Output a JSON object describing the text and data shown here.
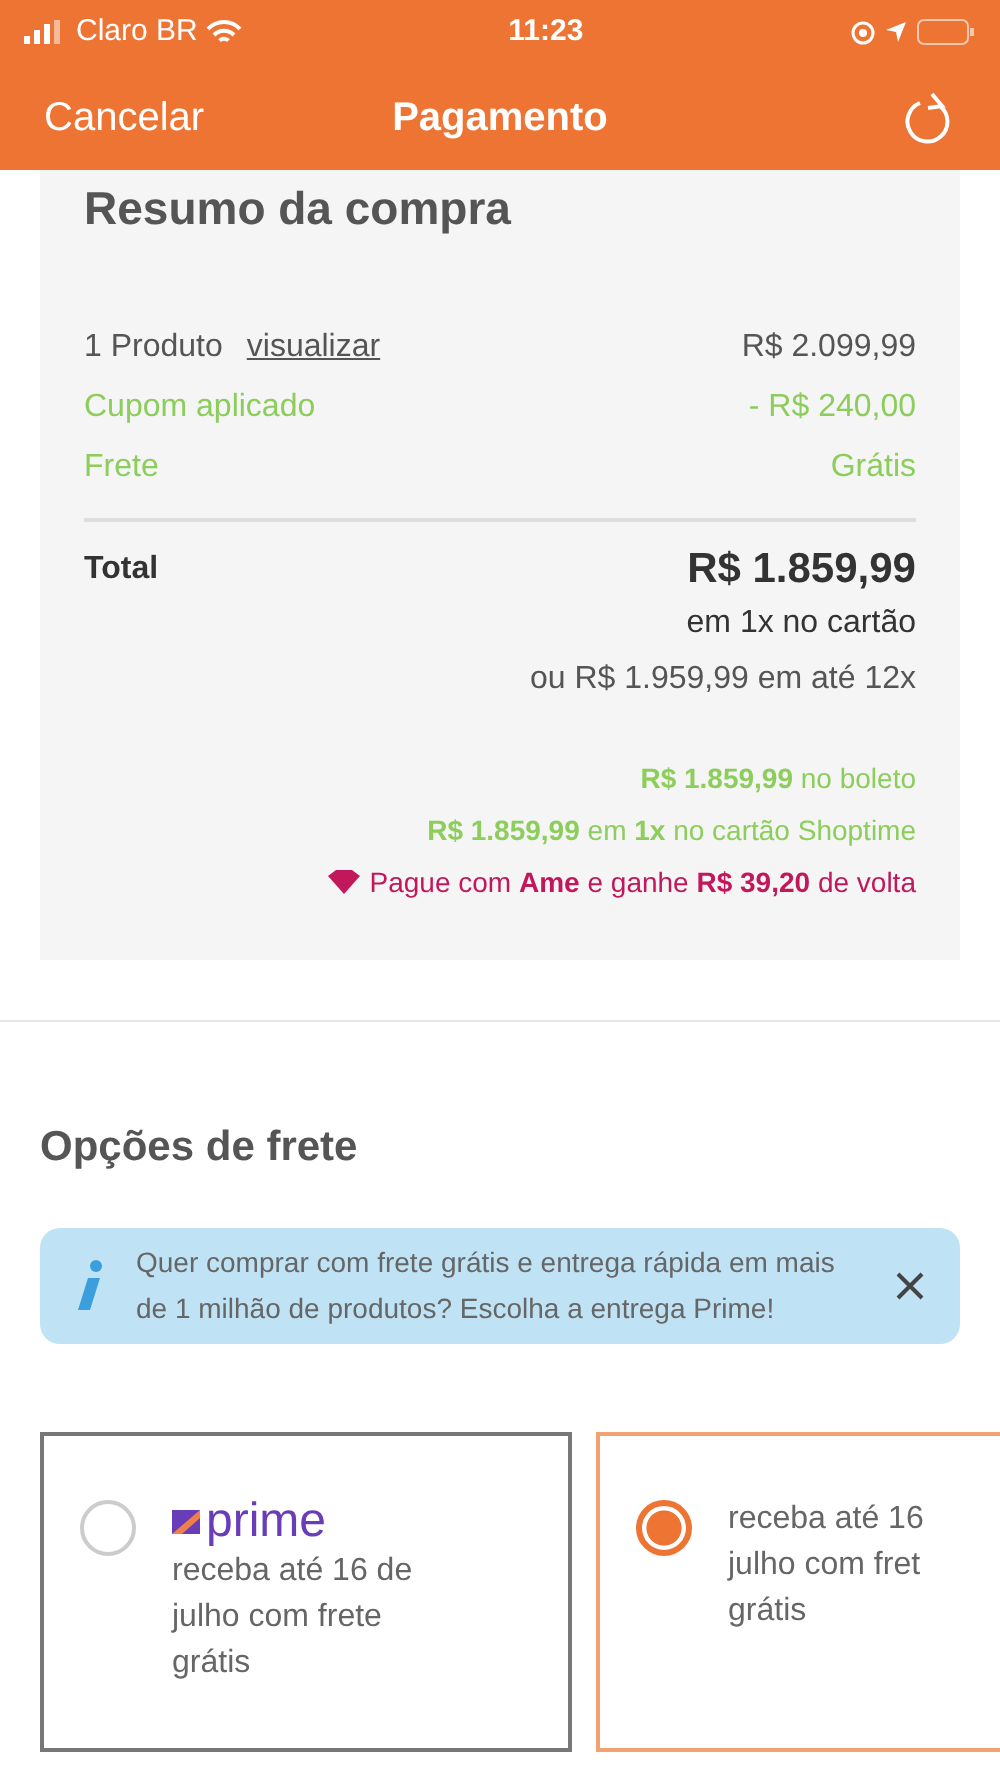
{
  "status_bar": {
    "carrier": "Claro BR",
    "time": "11:23"
  },
  "nav": {
    "left": "Cancelar",
    "title": "Pagamento"
  },
  "summary": {
    "title": "Resumo da compra",
    "rows": [
      {
        "kind": "product",
        "label": "1 Produto",
        "link": "visualizar",
        "value": "R$ 2.099,99"
      },
      {
        "kind": "discount",
        "label": "Cupom aplicado",
        "value": "- R$ 240,00"
      },
      {
        "kind": "discount",
        "label": "Frete",
        "value": "Grátis"
      }
    ],
    "total_label": "Total",
    "total": "R$ 1.859,99",
    "total_note": "em 1x no cartão",
    "installments": "ou R$ 1.959,99 em até 12x",
    "offers": [
      {
        "kind": "green",
        "text": "**R$ 1.859,99** no boleto"
      },
      {
        "kind": "green",
        "text": "**R$ 1.859,99** em **1x** no cartão Shoptime"
      },
      {
        "kind": "ame",
        "text": "Pague com **Ame** e ganhe **R$ 39,20** de volta"
      }
    ]
  },
  "shipping": {
    "title": "Opções de frete",
    "alert": "Quer comprar com frete grátis e entrega rápida em mais de 1 milhão de produtos? Escolha a entrega Prime!",
    "options": [
      {
        "selected": false,
        "logo": "prime",
        "lines": [
          "receba até 16 de",
          "julho com frete",
          "grátis"
        ]
      },
      {
        "selected": true,
        "lines": [
          "receba até 16",
          "julho com fret",
          "grátis"
        ]
      }
    ]
  }
}
